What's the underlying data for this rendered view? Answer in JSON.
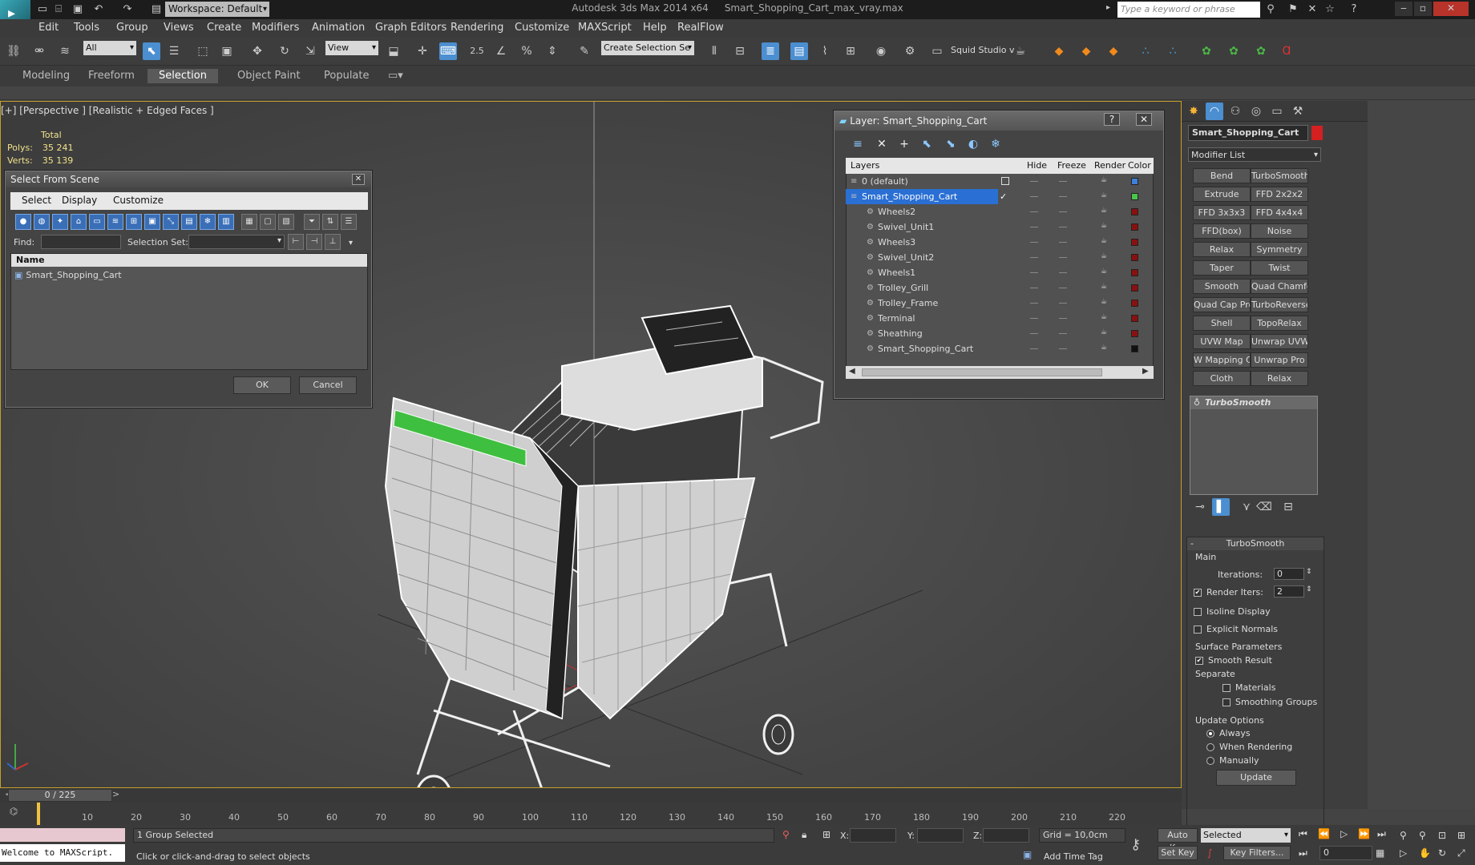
{
  "app": {
    "workspace": "Workspace: Default",
    "title_app": "Autodesk 3ds Max  2014 x64",
    "title_file": "Smart_Shopping_Cart_max_vray.max",
    "search_placeholder": "Type a keyword or phrase"
  },
  "menu": [
    "Edit",
    "Tools",
    "Group",
    "Views",
    "Create",
    "Modifiers",
    "Animation",
    "Graph Editors",
    "Rendering",
    "Customize",
    "MAXScript",
    "Help",
    "RealFlow"
  ],
  "toolbar": {
    "filter": "All",
    "coord_system": "View",
    "selection_set": "Create Selection Se",
    "snap_value": "2.5",
    "squid_label": "Squid Studio v"
  },
  "ribbon_tabs": [
    "Modeling",
    "Freeform",
    "Selection",
    "Object Paint",
    "Populate"
  ],
  "viewport": {
    "label": "[+] [Perspective ] [Realistic + Edged Faces ]",
    "stats_header": "Total",
    "polys_label": "Polys:",
    "polys_value": "35 241",
    "verts_label": "Verts:",
    "verts_value": "35 139"
  },
  "select_dialog": {
    "title": "Select From Scene",
    "menu": [
      "Select",
      "Display",
      "Customize"
    ],
    "find_label": "Find:",
    "selset_label": "Selection Set:",
    "col_name": "Name",
    "items": [
      "Smart_Shopping_Cart"
    ],
    "ok": "OK",
    "cancel": "Cancel"
  },
  "layer_dialog": {
    "title": "Layer: Smart_Shopping_Cart",
    "help": "?",
    "columns": [
      "Layers",
      "Hide",
      "Freeze",
      "Render",
      "Color"
    ],
    "rows": [
      {
        "name": "0 (default)",
        "color": "#3f7fd8"
      },
      {
        "name": "Smart_Shopping_Cart",
        "color": "#4cc44c"
      },
      {
        "name": "Wheels2",
        "color": "#8a1010"
      },
      {
        "name": "Swivel_Unit1",
        "color": "#8a1010"
      },
      {
        "name": "Wheels3",
        "color": "#8a1010"
      },
      {
        "name": "Swivel_Unit2",
        "color": "#8a1010"
      },
      {
        "name": "Wheels1",
        "color": "#8a1010"
      },
      {
        "name": "Trolley_Grill",
        "color": "#8a1010"
      },
      {
        "name": "Trolley_Frame",
        "color": "#8a1010"
      },
      {
        "name": "Terminal",
        "color": "#8a1010"
      },
      {
        "name": "Sheathing",
        "color": "#8a1010"
      },
      {
        "name": "Smart_Shopping_Cart",
        "color": "#111111"
      }
    ]
  },
  "command_panel": {
    "object_name": "Smart_Shopping_Cart",
    "object_color": "#d42020",
    "modifier_list": "Modifier List",
    "modifiers": [
      "Bend",
      "TurboSmooth",
      "Extrude",
      "FFD 2x2x2",
      "FFD 3x3x3",
      "FFD 4x4x4",
      "FFD(box)",
      "Noise",
      "Relax",
      "Symmetry",
      "Taper",
      "Twist",
      "Smooth",
      "Quad Chamfer",
      "Quad Cap Pro",
      "TurboReverse",
      "Shell",
      "TopoRelax",
      "UVW Map",
      "Unwrap UVW",
      "W Mapping Cle",
      "Unwrap Pro",
      "Cloth",
      "Relax"
    ],
    "stack_item": "TurboSmooth",
    "rollout_title": "TurboSmooth",
    "main_group": "Main",
    "iterations_label": "Iterations:",
    "iterations_value": "0",
    "render_iters_label": "Render Iters:",
    "render_iters_value": "2",
    "isoline": "Isoline Display",
    "explicit_normals": "Explicit Normals",
    "surface_group": "Surface Parameters",
    "smooth_result": "Smooth Result",
    "separate": "Separate",
    "materials": "Materials",
    "smoothing_groups": "Smoothing Groups",
    "update_group": "Update Options",
    "always": "Always",
    "when_rendering": "When Rendering",
    "manually": "Manually",
    "update_btn": "Update"
  },
  "timeline": {
    "frame": "0 / 225",
    "ticks": [
      "10",
      "20",
      "30",
      "40",
      "50",
      "60",
      "70",
      "80",
      "90",
      "100",
      "110",
      "120",
      "130",
      "140",
      "150",
      "160",
      "170",
      "180",
      "190",
      "200",
      "210",
      "220"
    ]
  },
  "status": {
    "maxscript": "Welcome to MAXScript.",
    "selected": "1 Group Selected",
    "prompt": "Click or click-and-drag to select objects",
    "x_label": "X:",
    "y_label": "Y:",
    "z_label": "Z:",
    "grid": "Grid = 10,0cm",
    "add_time_tag": "Add Time Tag",
    "auto_key": "Auto Key",
    "set_key": "Set Key",
    "key_mode": "Selected",
    "key_filters": "Key Filters...",
    "frame_value": "0"
  }
}
